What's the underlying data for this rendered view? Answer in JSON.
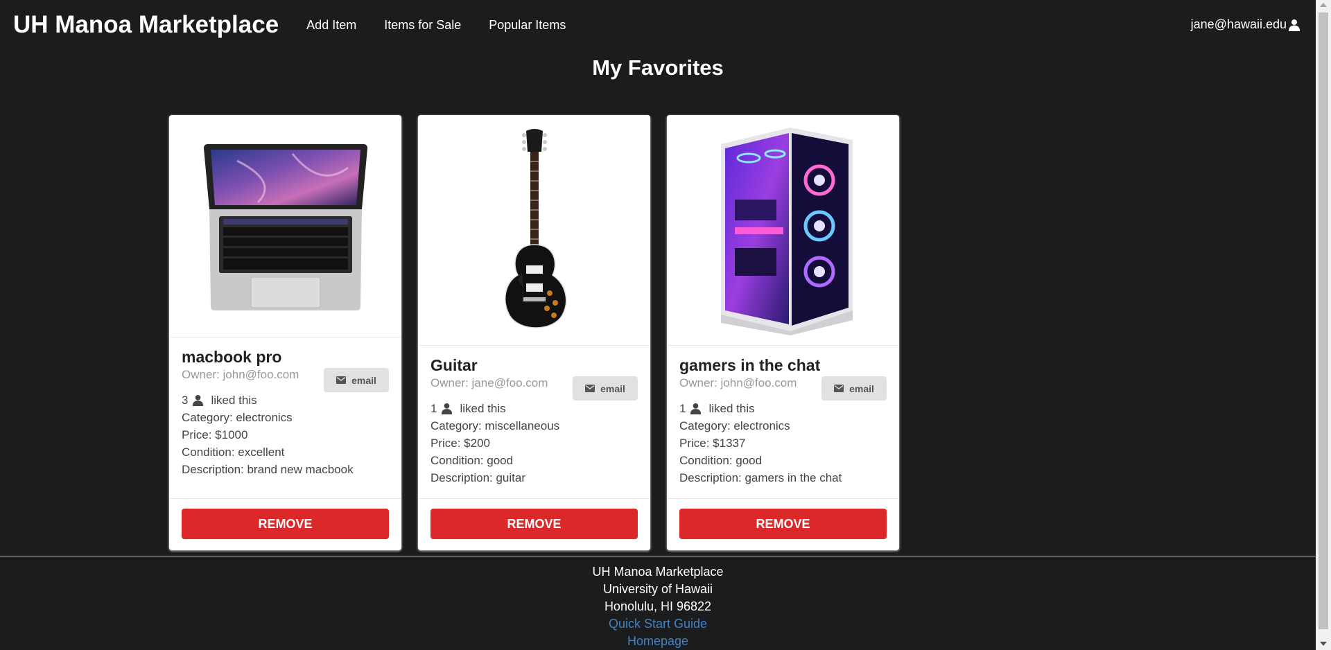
{
  "navbar": {
    "brand": "UH Manoa Marketplace",
    "links": [
      "Add Item",
      "Items for Sale",
      "Popular Items"
    ],
    "user": "jane@hawaii.edu",
    "user_icon": "user-icon"
  },
  "page_title": "My Favorites",
  "cards": [
    {
      "title": "macbook pro",
      "owner": "Owner: john@foo.com",
      "email_label": "email",
      "likes": "3",
      "likes_suffix": "liked this",
      "category": "Category: electronics",
      "price": "Price: $1000",
      "condition": "Condition: excellent",
      "description": "Description: brand new macbook",
      "remove_label": "REMOVE",
      "image": "laptop-image"
    },
    {
      "title": "Guitar",
      "owner": "Owner: jane@foo.com",
      "email_label": "email",
      "likes": "1",
      "likes_suffix": "liked this",
      "category": "Category: miscellaneous",
      "price": "Price: $200",
      "condition": "Condition: good",
      "description": "Description: guitar",
      "remove_label": "REMOVE",
      "image": "guitar-image"
    },
    {
      "title": "gamers in the chat",
      "owner": "Owner: john@foo.com",
      "email_label": "email",
      "likes": "1",
      "likes_suffix": "liked this",
      "category": "Category: electronics",
      "price": "Price: $1337",
      "condition": "Condition: good",
      "description": "Description: gamers in the chat",
      "remove_label": "REMOVE",
      "image": "gaming-pc-image"
    }
  ],
  "footer": {
    "line1": "UH Manoa Marketplace",
    "line2": "University of Hawaii",
    "line3": "Honolulu, HI 96822",
    "link1": "Quick Start Guide",
    "link2": "Homepage"
  },
  "colors": {
    "background": "#1b1c1d",
    "remove_button": "#db2828",
    "email_button": "#e0e1e2",
    "link": "#4183c4"
  }
}
